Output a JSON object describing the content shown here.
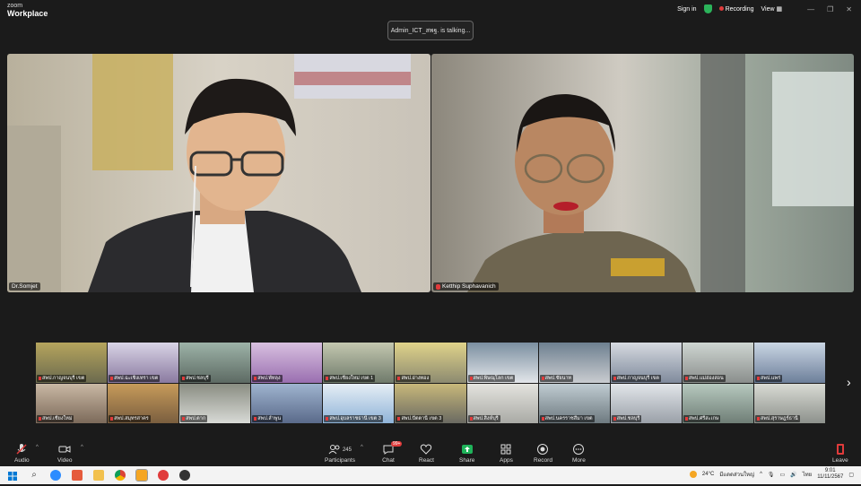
{
  "app": {
    "logo_top": "zoom",
    "logo_bottom": "Workplace"
  },
  "topbar": {
    "sign_in": "Sign in",
    "recording": "Recording",
    "view": "View"
  },
  "talking": "Admin_ICT_สพฐ. is talking...",
  "speakers": [
    {
      "name": "Dr.Somjet"
    },
    {
      "name": "Ketthip Suphavanich"
    }
  ],
  "gallery": [
    {
      "label": "สพป.กาญจนบุรี เขต"
    },
    {
      "label": "สพป.ฉะเชิงเทรา เขต"
    },
    {
      "label": "สพป.ชลบุรี"
    },
    {
      "label": "สพป.พัทลุง"
    },
    {
      "label": "สพป.เชียงใหม่ เขต 1"
    },
    {
      "label": "สพป.อ่างทอง"
    },
    {
      "label": "สพป.พิษณุโลก เขต"
    },
    {
      "label": "สพป.ชัยนาท"
    },
    {
      "label": "สพป.กาญจนบุรี เขต"
    },
    {
      "label": "สพป.แม่ฮ่องสอน"
    },
    {
      "label": "สพป.แพร่"
    },
    {
      "label": "สพป.เชียงใหม่"
    },
    {
      "label": "สพป.สมุทรสาคร"
    },
    {
      "label": "สพป.ตาก"
    },
    {
      "label": "สพป.ลำพูน"
    },
    {
      "label": "สพป.อุบลราชธานี เขต 3"
    },
    {
      "label": "สพป.ปัตตานี เขต 3"
    },
    {
      "label": "สพป.สิงห์บุรี"
    },
    {
      "label": "สพป.นครราชสีมา เขต"
    },
    {
      "label": "สพป.ชลบุรี"
    },
    {
      "label": "สพป.ศรีสะเกษ"
    },
    {
      "label": "สพป.สุราษฎร์ธานี"
    }
  ],
  "toolbar": {
    "audio": "Audio",
    "video": "Video",
    "participants": "Participants",
    "participant_count": "245",
    "chat": "Chat",
    "chat_badge": "99+",
    "react": "React",
    "share": "Share",
    "apps": "Apps",
    "record": "Record",
    "more": "More",
    "leave": "Leave"
  },
  "taskbar": {
    "weather": "24°C",
    "weather_desc": "มีแดดส่วนใหญ่",
    "lang": "ไทย",
    "time": "9:01",
    "date": "11/11/2567"
  },
  "colors": {
    "accent_green": "#2bb35a",
    "share_green": "#1fb35a",
    "recording_red": "#e03b3b"
  }
}
